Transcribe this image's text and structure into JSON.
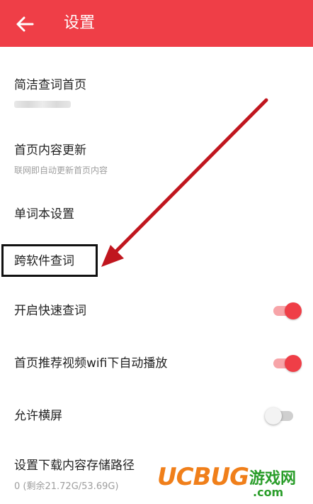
{
  "header": {
    "title": "设置",
    "back_icon": "arrow-left-icon",
    "bg_color": "#ef3e47"
  },
  "settings": {
    "concise_home": {
      "label": "简洁查词首页"
    },
    "home_update": {
      "label": "首页内容更新",
      "description": "联网即自动更新首页内容"
    },
    "wordbook": {
      "label": "单词本设置"
    },
    "cross_app": {
      "label": "跨软件查词"
    },
    "quick_lookup": {
      "label": "开启快速查词",
      "enabled": true
    },
    "autoplay_video": {
      "label": "首页推荐视频wifi下自动播放",
      "enabled": true
    },
    "landscape": {
      "label": "允许横屏",
      "enabled": false
    },
    "download_path": {
      "label": "设置下载内容存储路径",
      "value": "0 (剩余21.72G/53.69G)"
    }
  },
  "watermark": {
    "brand": "UCBUG",
    "text1": "游戏网",
    "text2": ".com"
  },
  "colors": {
    "accent": "#ef3e47",
    "toggle_on_track": "#f7a4a8",
    "annotation_arrow": "#c0161e"
  }
}
